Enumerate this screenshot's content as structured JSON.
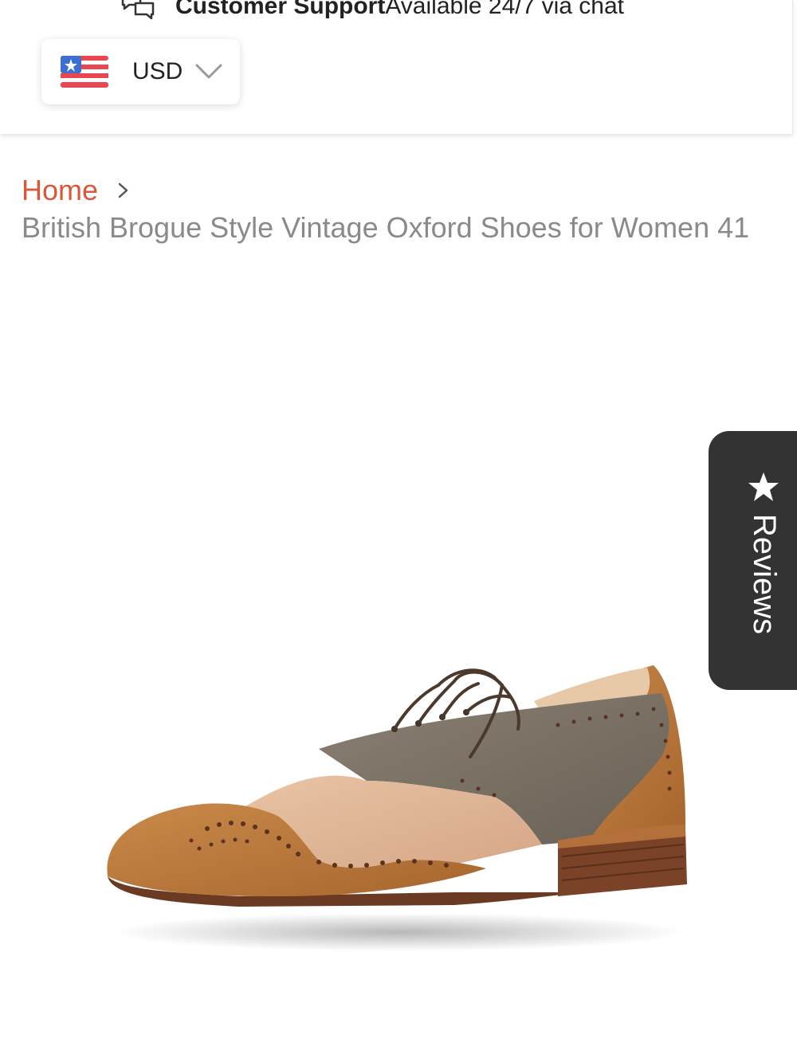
{
  "header": {
    "support_title": "Customer Support",
    "support_subtitle": "Available 24/7 via chat",
    "currency": {
      "code": "USD",
      "flag_icon": "us-flag-icon"
    }
  },
  "breadcrumb": {
    "home_label": "Home",
    "current": "British Brogue Style Vintage Oxford Shoes for Women 41"
  },
  "reviews_tab": {
    "label": "Reviews",
    "icon": "star-icon"
  },
  "colors": {
    "accent": "#d9573a",
    "title_gray": "#8a8a8a",
    "reviews_bg": "#333333"
  }
}
